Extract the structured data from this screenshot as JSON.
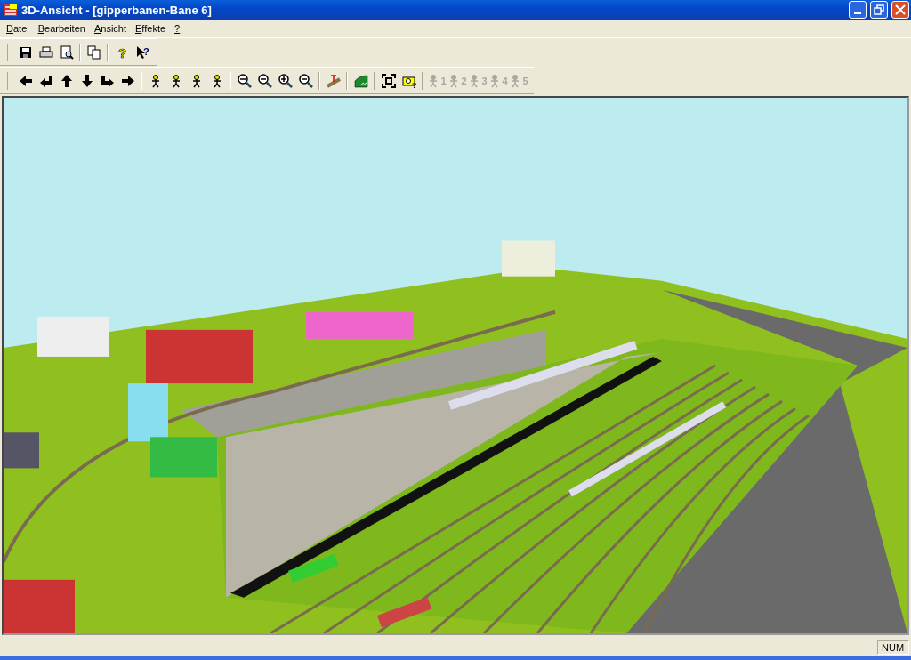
{
  "window": {
    "title": "3D-Ansicht - [gipperbanen-Bane 6]"
  },
  "menu": [
    {
      "label": "Datei"
    },
    {
      "label": "Bearbeiten"
    },
    {
      "label": "Ansicht"
    },
    {
      "label": "Effekte"
    },
    {
      "label": "?"
    }
  ],
  "toolbar_1": [
    {
      "kind": "save"
    },
    {
      "kind": "print"
    },
    {
      "kind": "preview"
    },
    {
      "kind": "sep"
    },
    {
      "kind": "copy"
    },
    {
      "kind": "sep"
    },
    {
      "kind": "help"
    },
    {
      "kind": "whatsthis"
    }
  ],
  "toolbar_2": [
    {
      "kind": "left"
    },
    {
      "kind": "turnleft"
    },
    {
      "kind": "up"
    },
    {
      "kind": "down"
    },
    {
      "kind": "turnright"
    },
    {
      "kind": "right"
    },
    {
      "kind": "sep"
    },
    {
      "kind": "person"
    },
    {
      "kind": "person"
    },
    {
      "kind": "person"
    },
    {
      "kind": "person"
    },
    {
      "kind": "sep"
    },
    {
      "kind": "zoom"
    },
    {
      "kind": "zoomout"
    },
    {
      "kind": "zoomin"
    },
    {
      "kind": "zoom"
    },
    {
      "kind": "sep"
    },
    {
      "kind": "track"
    },
    {
      "kind": "sep"
    },
    {
      "kind": "terrain"
    },
    {
      "kind": "sep"
    },
    {
      "kind": "fit"
    },
    {
      "kind": "camera"
    },
    {
      "kind": "sep"
    },
    {
      "kind": "viewpoint",
      "label": "1",
      "disabled": true
    },
    {
      "kind": "viewpoint",
      "label": "2",
      "disabled": true
    },
    {
      "kind": "viewpoint",
      "label": "3",
      "disabled": true
    },
    {
      "kind": "viewpoint",
      "label": "4",
      "disabled": true
    },
    {
      "kind": "viewpoint",
      "label": "5",
      "disabled": true
    }
  ],
  "status_bar": {
    "indicator": "NUM"
  }
}
